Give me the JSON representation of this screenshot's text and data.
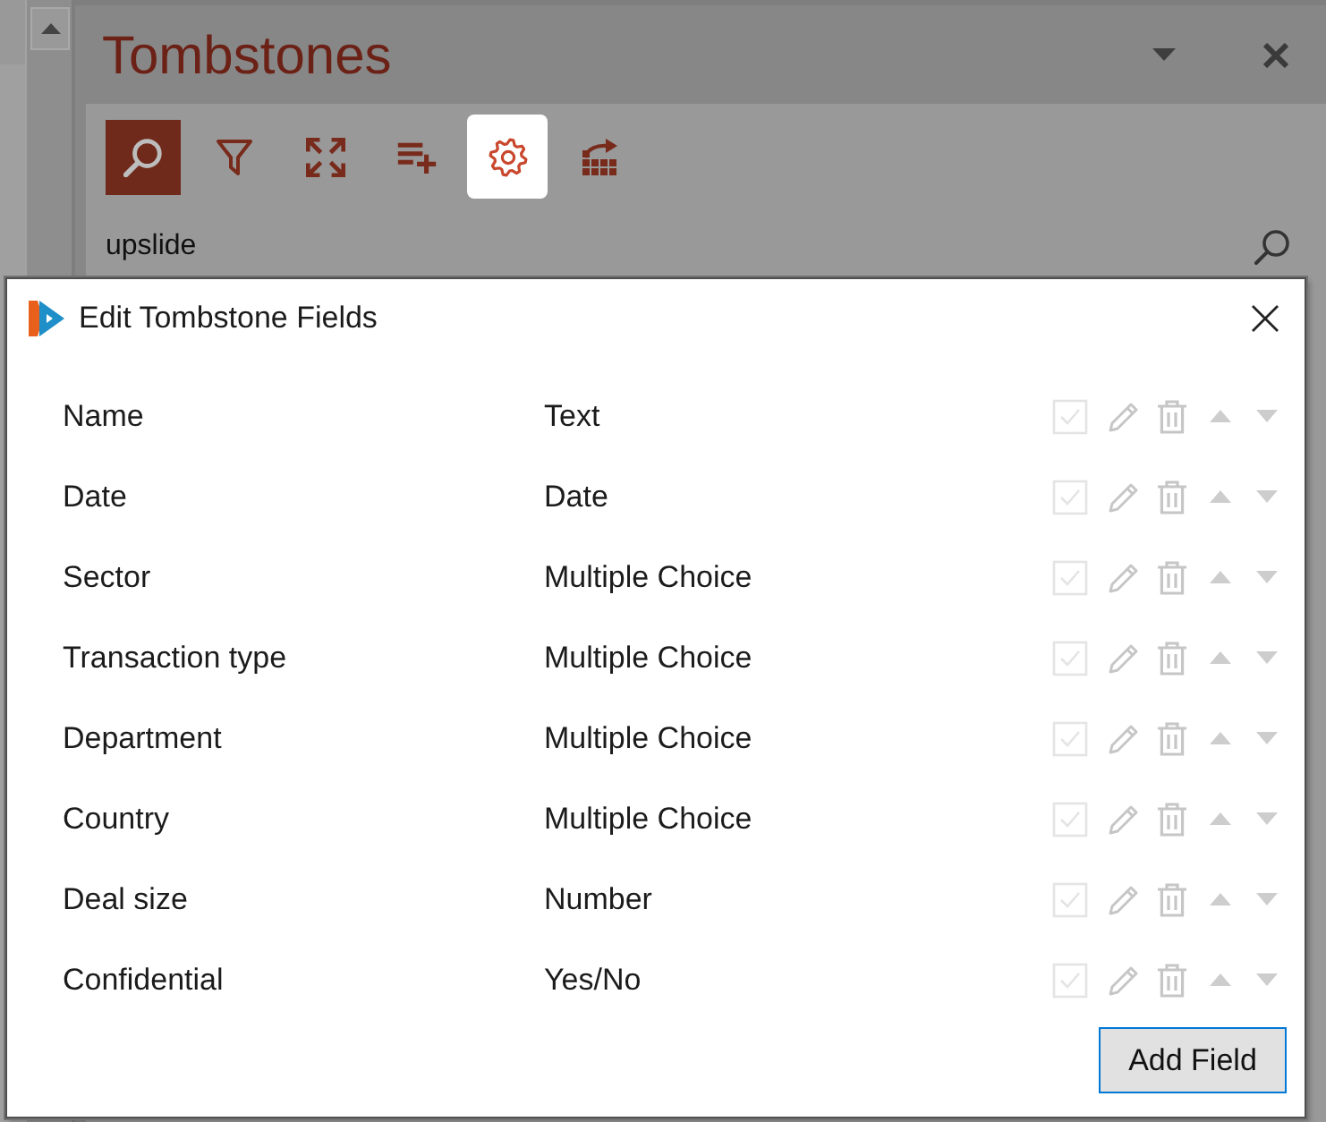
{
  "pane": {
    "title": "Tombstones",
    "toolbar": [
      {
        "kind": "search",
        "selected": true,
        "highlighted": false
      },
      {
        "kind": "filter",
        "selected": false,
        "highlighted": false
      },
      {
        "kind": "expand",
        "selected": false,
        "highlighted": false
      },
      {
        "kind": "add_list",
        "selected": false,
        "highlighted": false
      },
      {
        "kind": "settings",
        "selected": false,
        "highlighted": true
      },
      {
        "kind": "export",
        "selected": false,
        "highlighted": false
      }
    ],
    "search": {
      "value": "upslide"
    }
  },
  "dialog": {
    "title": "Edit Tombstone Fields",
    "fields": [
      {
        "name": "Name",
        "type": "Text",
        "disabled": true
      },
      {
        "name": "Date",
        "type": "Date",
        "disabled": true
      },
      {
        "name": "Sector",
        "type": "Multiple Choice",
        "disabled": true
      },
      {
        "name": "Transaction type",
        "type": "Multiple Choice",
        "disabled": true
      },
      {
        "name": "Department",
        "type": "Multiple Choice",
        "disabled": true
      },
      {
        "name": "Country",
        "type": "Multiple Choice",
        "disabled": true
      },
      {
        "name": "Deal size",
        "type": "Number",
        "disabled": true
      },
      {
        "name": "Confidential",
        "type": "Yes/No",
        "disabled": true
      }
    ],
    "add_button": {
      "label": "Add Field",
      "focused": true
    }
  }
}
